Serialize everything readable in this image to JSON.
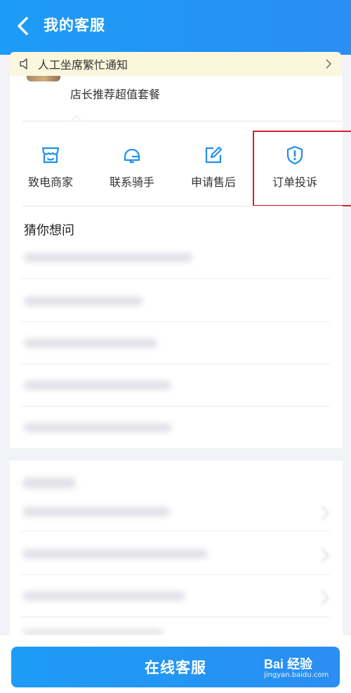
{
  "header": {
    "title": "我的客服"
  },
  "notice": {
    "text": "人工坐席繁忙通知"
  },
  "order": {
    "combo": "店长推荐超值套餐"
  },
  "actions": [
    {
      "label": "致电商家",
      "icon": "shop-icon"
    },
    {
      "label": "联系骑手",
      "icon": "rider-helmet-icon"
    },
    {
      "label": "申请售后",
      "icon": "edit-icon"
    },
    {
      "label": "订单投诉",
      "icon": "complaint-shield-icon"
    }
  ],
  "guess": {
    "title": "猜你想问"
  },
  "footer": {
    "service_button": "在线客服"
  },
  "watermark": {
    "brand": "Bai  经验",
    "url": "jingyan.baidu.com"
  },
  "colors": {
    "primary": "#2196f3",
    "highlight": "#d7202a",
    "notice_bg": "#fbf7dc"
  }
}
